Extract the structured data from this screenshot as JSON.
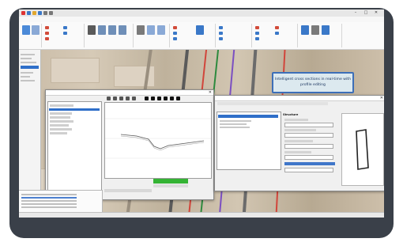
{
  "window": {
    "title": "",
    "controls": [
      "–",
      "□",
      "✕"
    ]
  },
  "quick_access_icons": [
    "app-logo-icon",
    "new-file-icon",
    "open-folder-icon",
    "save-icon",
    "undo-icon",
    "redo-icon"
  ],
  "menu": [],
  "ribbon": {
    "groups": 10
  },
  "callout": {
    "text": "Intelligent cross sections in real-time with profile editing"
  },
  "profile_dialog": {
    "tabs": [
      "",
      ""
    ],
    "status_value": ""
  },
  "properties_dialog": {
    "heading": "Structure"
  },
  "status_bar": {
    "items": []
  },
  "colors": {
    "accent": "#2f6fc9",
    "bezel": "#3a4049",
    "progress": "#34b334"
  }
}
